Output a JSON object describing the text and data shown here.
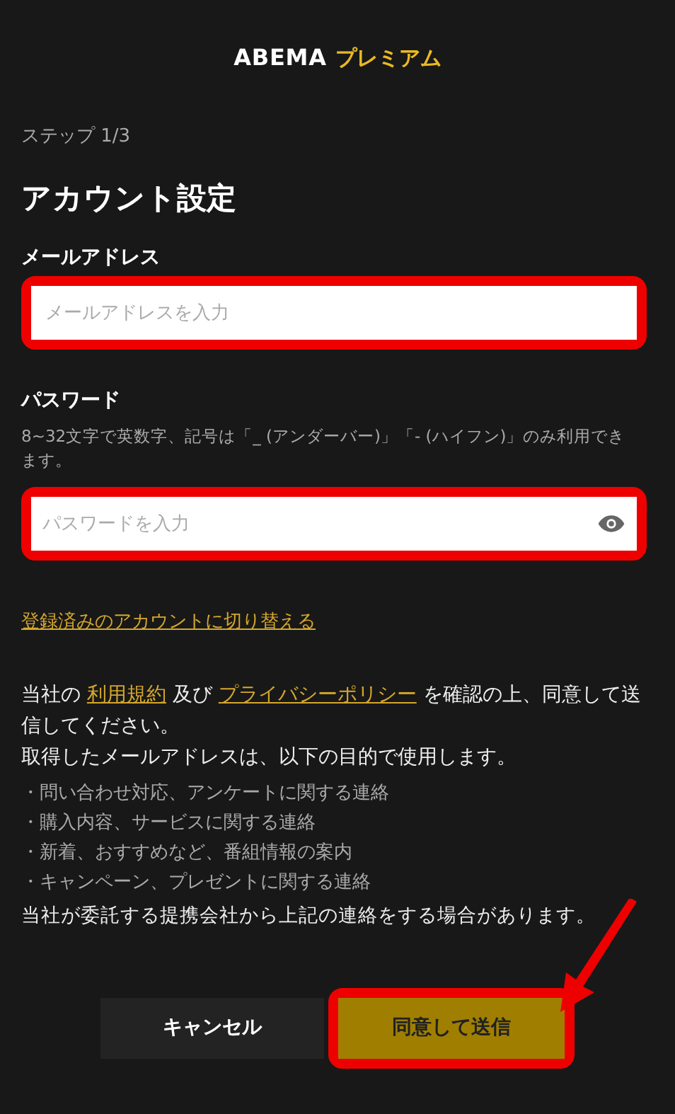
{
  "logo": {
    "brand": "ABEMA",
    "product": "プレミアム"
  },
  "step": "ステップ 1/3",
  "title": "アカウント設定",
  "email": {
    "label": "メールアドレス",
    "placeholder": "メールアドレスを入力",
    "highlighted": true
  },
  "password": {
    "label": "パスワード",
    "hint": "8~32文字で英数字、記号は「_ (アンダーバー)」「- (ハイフン)」のみ利用できます。",
    "placeholder": "パスワードを入力",
    "highlighted": true
  },
  "switch_link": "登録済みのアカウントに切り替える",
  "consent": {
    "before": "当社の",
    "terms": "利用規約",
    "middle": "及び",
    "privacy": "プライバシーポリシー",
    "after": "を確認の上、同意して送信してください。"
  },
  "purpose_intro": "取得したメールアドレスは、以下の目的で使用します。",
  "purposes": [
    "・問い合わせ対応、アンケートに関する連絡",
    "・購入内容、サービスに関する連絡",
    "・新着、おすすめなど、番組情報の案内",
    "・キャンペーン、プレゼントに関する連絡"
  ],
  "affiliate_note": "当社が委託する提携会社から上記の連絡をする場合があります。",
  "buttons": [
    {
      "kind": "cancel",
      "label": "キャンセル",
      "highlighted": false
    },
    {
      "kind": "submit",
      "label": "同意して送信",
      "highlighted": true
    }
  ],
  "annotation_arrow": true
}
